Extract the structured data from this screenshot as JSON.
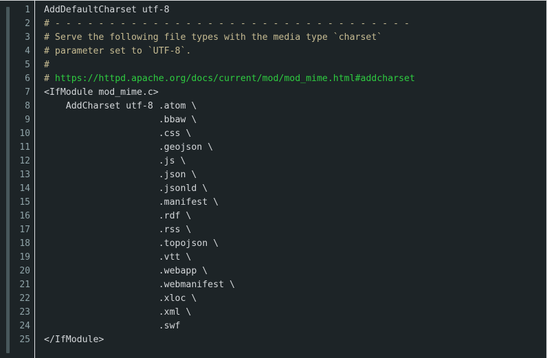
{
  "editor": {
    "title": "code-viewer",
    "language": "apacheconf",
    "theme_background": "#1d2427",
    "gutter_color": "#8fa3a8",
    "text_color": "#d4d7da",
    "comment_color": "#c6bb92",
    "link_color": "#2ecc40",
    "separator_color": "#e3e5e7",
    "scrollbar_color": "#48585c",
    "first_line_number": 1,
    "last_line_number": 25,
    "total_lines": 25
  },
  "line_numbers": [
    "1",
    "2",
    "3",
    "4",
    "5",
    "6",
    "7",
    "8",
    "9",
    "10",
    "11",
    "12",
    "13",
    "14",
    "15",
    "16",
    "17",
    "18",
    "19",
    "20",
    "21",
    "22",
    "23",
    "24",
    "25"
  ],
  "lines": [
    {
      "number": "1",
      "text": "AddDefaultCharset utf-8",
      "tokens": [
        {
          "type": "plain",
          "text": "AddDefaultCharset utf-8"
        }
      ]
    },
    {
      "number": "2",
      "text": "# - - - - - - - - - - - - - - - - - - - - - - - - - - - - - - - - -",
      "tokens": [
        {
          "type": "comment",
          "text": "# - - - - - - - - - - - - - - - - - - - - - - - - - - - - - - - - -"
        }
      ]
    },
    {
      "number": "3",
      "text": "# Serve the following file types with the media type `charset`",
      "tokens": [
        {
          "type": "comment",
          "text": "# Serve the following file types with the media type `charset`"
        }
      ]
    },
    {
      "number": "4",
      "text": "# parameter set to `UTF-8`.",
      "tokens": [
        {
          "type": "comment",
          "text": "# parameter set to `UTF-8`."
        }
      ]
    },
    {
      "number": "5",
      "text": "#",
      "tokens": [
        {
          "type": "comment",
          "text": "#"
        }
      ]
    },
    {
      "number": "6",
      "text": "# https://httpd.apache.org/docs/current/mod/mod_mime.html#addcharset",
      "tokens": [
        {
          "type": "comment",
          "text": "# "
        },
        {
          "type": "link",
          "text": "https://httpd.apache.org/docs/current/mod/mod_mime.html#addcharset"
        }
      ]
    },
    {
      "number": "7",
      "text": "<IfModule mod_mime.c>",
      "tokens": [
        {
          "type": "plain",
          "text": "<IfModule mod_mime.c>"
        }
      ]
    },
    {
      "number": "8",
      "text": "    AddCharset utf-8 .atom \\",
      "tokens": [
        {
          "type": "plain",
          "text": "    AddCharset utf-8 .atom \\"
        }
      ]
    },
    {
      "number": "9",
      "text": "                     .bbaw \\",
      "tokens": [
        {
          "type": "plain",
          "text": "                     .bbaw \\"
        }
      ]
    },
    {
      "number": "10",
      "text": "                     .css \\",
      "tokens": [
        {
          "type": "plain",
          "text": "                     .css \\"
        }
      ]
    },
    {
      "number": "11",
      "text": "                     .geojson \\",
      "tokens": [
        {
          "type": "plain",
          "text": "                     .geojson \\"
        }
      ]
    },
    {
      "number": "12",
      "text": "                     .js \\",
      "tokens": [
        {
          "type": "plain",
          "text": "                     .js \\"
        }
      ]
    },
    {
      "number": "13",
      "text": "                     .json \\",
      "tokens": [
        {
          "type": "plain",
          "text": "                     .json \\"
        }
      ]
    },
    {
      "number": "14",
      "text": "                     .jsonld \\",
      "tokens": [
        {
          "type": "plain",
          "text": "                     .jsonld \\"
        }
      ]
    },
    {
      "number": "15",
      "text": "                     .manifest \\",
      "tokens": [
        {
          "type": "plain",
          "text": "                     .manifest \\"
        }
      ]
    },
    {
      "number": "16",
      "text": "                     .rdf \\",
      "tokens": [
        {
          "type": "plain",
          "text": "                     .rdf \\"
        }
      ]
    },
    {
      "number": "17",
      "text": "                     .rss \\",
      "tokens": [
        {
          "type": "plain",
          "text": "                     .rss \\"
        }
      ]
    },
    {
      "number": "18",
      "text": "                     .topojson \\",
      "tokens": [
        {
          "type": "plain",
          "text": "                     .topojson \\"
        }
      ]
    },
    {
      "number": "19",
      "text": "                     .vtt \\",
      "tokens": [
        {
          "type": "plain",
          "text": "                     .vtt \\"
        }
      ]
    },
    {
      "number": "20",
      "text": "                     .webapp \\",
      "tokens": [
        {
          "type": "plain",
          "text": "                     .webapp \\"
        }
      ]
    },
    {
      "number": "21",
      "text": "                     .webmanifest \\",
      "tokens": [
        {
          "type": "plain",
          "text": "                     .webmanifest \\"
        }
      ]
    },
    {
      "number": "22",
      "text": "                     .xloc \\",
      "tokens": [
        {
          "type": "plain",
          "text": "                     .xloc \\"
        }
      ]
    },
    {
      "number": "23",
      "text": "                     .xml \\",
      "tokens": [
        {
          "type": "plain",
          "text": "                     .xml \\"
        }
      ]
    },
    {
      "number": "24",
      "text": "                     .swf",
      "tokens": [
        {
          "type": "plain",
          "text": "                     .swf"
        }
      ]
    },
    {
      "number": "25",
      "text": "</IfModule>",
      "tokens": [
        {
          "type": "plain",
          "text": "</IfModule>"
        }
      ]
    }
  ]
}
